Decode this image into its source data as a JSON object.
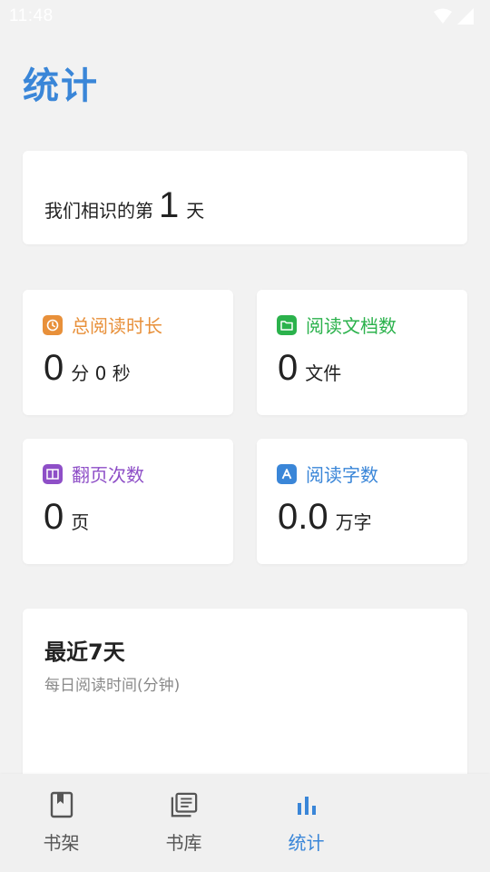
{
  "status_bar": {
    "time": "11:48"
  },
  "page": {
    "title": "统计"
  },
  "days_card": {
    "prefix": "我们相识的第",
    "count": "1",
    "suffix": "天"
  },
  "stats": [
    {
      "label": "总阅读时长",
      "value": "0",
      "unit": "分 0 秒",
      "color": "#e8903a",
      "icon": "clock-icon"
    },
    {
      "label": "阅读文档数",
      "value": "0",
      "unit": "文件",
      "color": "#2bb24c",
      "icon": "folder-icon"
    },
    {
      "label": "翻页次数",
      "value": "0",
      "unit": "页",
      "color": "#8e4fc7",
      "icon": "book-open-icon"
    },
    {
      "label": "阅读字数",
      "value": "0.0",
      "unit": "万字",
      "color": "#3a86d8",
      "icon": "letter-a-icon"
    }
  ],
  "recent": {
    "title": "最近7天",
    "subtitle": "每日阅读时间(分钟)"
  },
  "nav": {
    "items": [
      {
        "label": "书架",
        "icon": "bookmark-book-icon",
        "active": false
      },
      {
        "label": "书库",
        "icon": "library-icon",
        "active": false
      },
      {
        "label": "",
        "icon": "",
        "active": false
      },
      {
        "label": "统计",
        "icon": "bar-chart-icon",
        "active": true
      }
    ]
  },
  "colors": {
    "accent": "#3a86d8",
    "background": "#f2f2f2"
  }
}
